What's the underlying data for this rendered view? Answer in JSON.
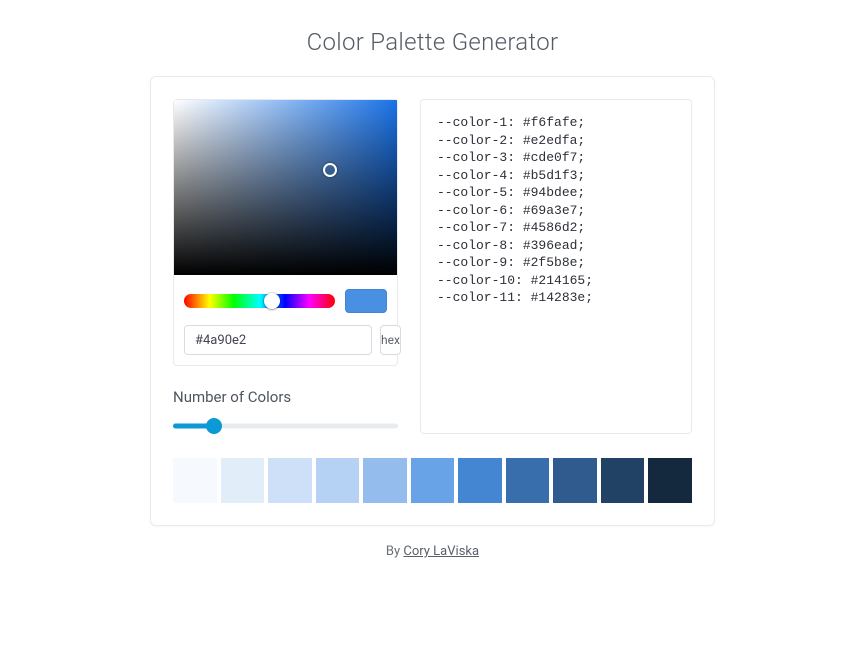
{
  "title": "Color Palette Generator",
  "picker": {
    "hex_value": "#4a90e2",
    "format_label": "hex",
    "swatch_color": "#4a90e2"
  },
  "slider_label": "Number of Colors",
  "colors": [
    {
      "var": "--color-1",
      "hex": "#f6fafe"
    },
    {
      "var": "--color-2",
      "hex": "#e2edfa"
    },
    {
      "var": "--color-3",
      "hex": "#cde0f7"
    },
    {
      "var": "--color-4",
      "hex": "#b5d1f3"
    },
    {
      "var": "--color-5",
      "hex": "#94bdee"
    },
    {
      "var": "--color-6",
      "hex": "#69a3e7"
    },
    {
      "var": "--color-7",
      "hex": "#4586d2"
    },
    {
      "var": "--color-8",
      "hex": "#396ead"
    },
    {
      "var": "--color-9",
      "hex": "#2f5b8e"
    },
    {
      "var": "--color-10",
      "hex": "#214165"
    },
    {
      "var": "--color-11",
      "hex": "#14283e"
    }
  ],
  "footer": {
    "prefix": "By ",
    "author": "Cory LaViska"
  }
}
